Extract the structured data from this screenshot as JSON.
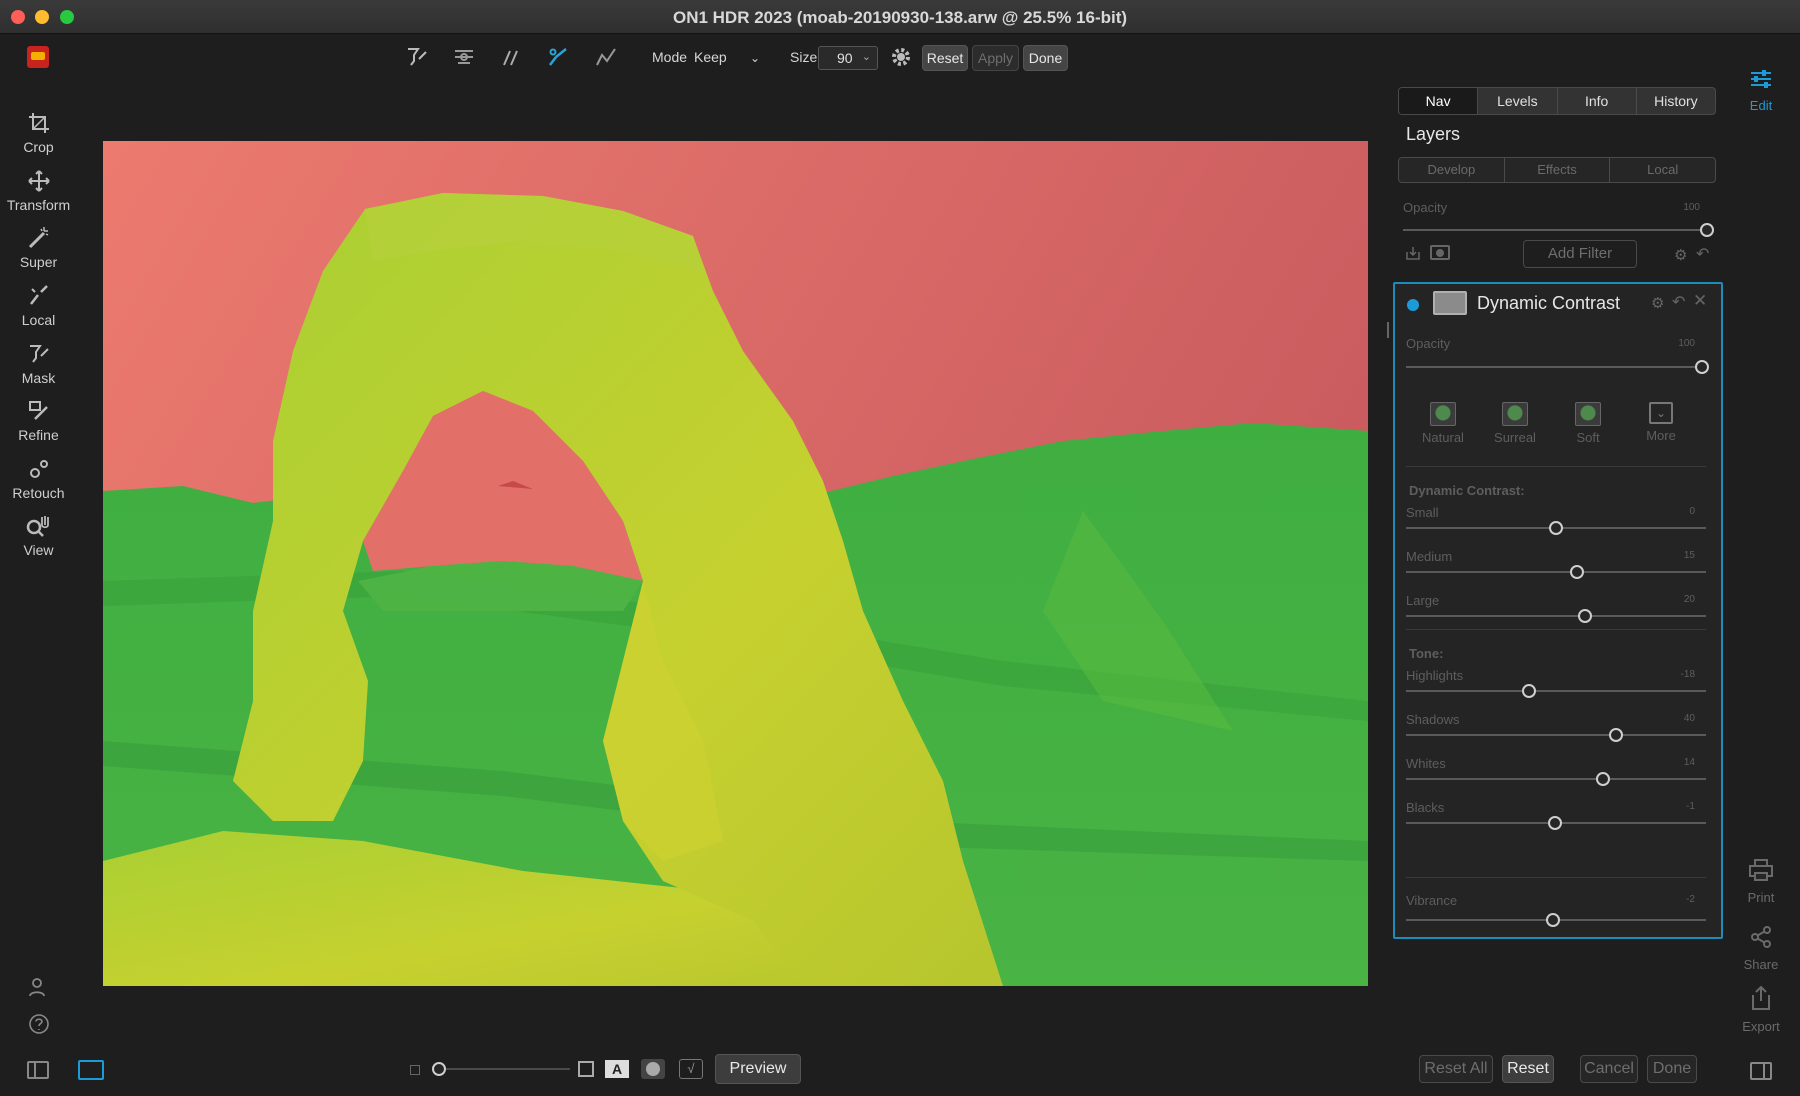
{
  "window": {
    "title": "ON1 HDR 2023 (moab-20190930-138.arw @ 25.5% 16-bit)"
  },
  "toolbar": {
    "mode_label": "Mode",
    "mode_value": "Keep",
    "size_label": "Size",
    "size_value": "90",
    "reset_label": "Reset",
    "apply_label": "Apply",
    "done_label": "Done"
  },
  "left_tools": [
    {
      "label": "Crop",
      "icon": "crop-icon"
    },
    {
      "label": "Transform",
      "icon": "move-arrows-icon"
    },
    {
      "label": "Super",
      "icon": "magic-brush-icon"
    },
    {
      "label": "Local",
      "icon": "local-brush-icon"
    },
    {
      "label": "Mask",
      "icon": "mask-brush-icon"
    },
    {
      "label": "Refine",
      "icon": "refine-brush-icon"
    },
    {
      "label": "Retouch",
      "icon": "retouch-icon"
    },
    {
      "label": "View",
      "icon": "magnify-hand-icon"
    }
  ],
  "right_rail": {
    "edit_label": "Edit",
    "print_label": "Print",
    "share_label": "Share",
    "export_label": "Export"
  },
  "panel": {
    "tabs": [
      "Nav",
      "Levels",
      "Info",
      "History"
    ],
    "active_tab": "Nav",
    "layers_title": "Layers",
    "sub_tabs": [
      "Develop",
      "Effects",
      "Local"
    ],
    "layer_opacity_label": "Opacity",
    "layer_opacity_value": "100",
    "add_filter_label": "Add Filter",
    "filter": {
      "title": "Dynamic Contrast",
      "opacity_label": "Opacity",
      "opacity_value": "100",
      "presets": [
        "Natural",
        "Surreal",
        "Soft",
        "More"
      ],
      "dc_section": "Dynamic Contrast:",
      "dc_sliders": [
        {
          "label": "Small",
          "value": "0",
          "pos": 0.5
        },
        {
          "label": "Medium",
          "value": "15",
          "pos": 0.57
        },
        {
          "label": "Large",
          "value": "20",
          "pos": 0.595
        }
      ],
      "tone_section": "Tone:",
      "tone_sliders": [
        {
          "label": "Highlights",
          "value": "-18",
          "pos": 0.41
        },
        {
          "label": "Shadows",
          "value": "40",
          "pos": 0.7
        },
        {
          "label": "Whites",
          "value": "14",
          "pos": 0.655
        },
        {
          "label": "Blacks",
          "value": "-1",
          "pos": 0.495
        }
      ],
      "vibrance_label": "Vibrance",
      "vibrance_value": "-2",
      "vibrance_pos": 0.49
    }
  },
  "bottom": {
    "preview_label": "Preview",
    "reset_all_label": "Reset All",
    "reset_label": "Reset",
    "cancel_label": "Cancel",
    "done_label": "Done"
  },
  "colors": {
    "accent": "#1d8cba",
    "mask_keep": "#3fb83f",
    "mask_drop": "#e0706b",
    "mask_overlap": "#c8cf33"
  }
}
